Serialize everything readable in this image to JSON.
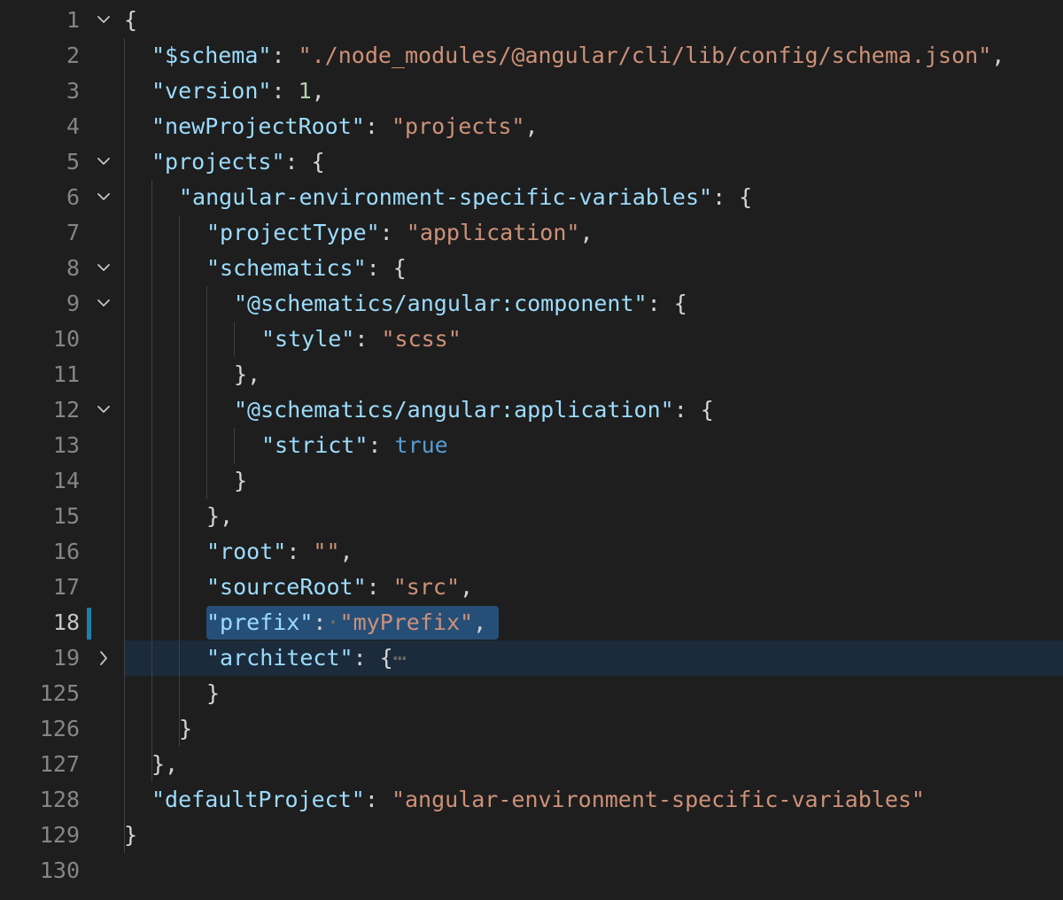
{
  "editor": {
    "lines": [
      {
        "num": "1",
        "fold": "open",
        "tokens": [
          {
            "t": "p",
            "v": "{"
          }
        ]
      },
      {
        "num": "2",
        "fold": "",
        "tokens": [
          {
            "t": "k",
            "v": "\"$schema\""
          },
          {
            "t": "p",
            "v": ": "
          },
          {
            "t": "s",
            "v": "\"./node_modules/@angular/cli/lib/config/schema.json\""
          },
          {
            "t": "p",
            "v": ","
          }
        ]
      },
      {
        "num": "3",
        "fold": "",
        "tokens": [
          {
            "t": "k",
            "v": "\"version\""
          },
          {
            "t": "p",
            "v": ": "
          },
          {
            "t": "n",
            "v": "1"
          },
          {
            "t": "p",
            "v": ","
          }
        ]
      },
      {
        "num": "4",
        "fold": "",
        "tokens": [
          {
            "t": "k",
            "v": "\"newProjectRoot\""
          },
          {
            "t": "p",
            "v": ": "
          },
          {
            "t": "s",
            "v": "\"projects\""
          },
          {
            "t": "p",
            "v": ","
          }
        ]
      },
      {
        "num": "5",
        "fold": "open",
        "tokens": [
          {
            "t": "k",
            "v": "\"projects\""
          },
          {
            "t": "p",
            "v": ": {"
          }
        ]
      },
      {
        "num": "6",
        "fold": "open",
        "tokens": [
          {
            "t": "k",
            "v": "\"angular-environment-specific-variables\""
          },
          {
            "t": "p",
            "v": ": {"
          }
        ]
      },
      {
        "num": "7",
        "fold": "",
        "tokens": [
          {
            "t": "k",
            "v": "\"projectType\""
          },
          {
            "t": "p",
            "v": ": "
          },
          {
            "t": "s",
            "v": "\"application\""
          },
          {
            "t": "p",
            "v": ","
          }
        ]
      },
      {
        "num": "8",
        "fold": "open",
        "tokens": [
          {
            "t": "k",
            "v": "\"schematics\""
          },
          {
            "t": "p",
            "v": ": {"
          }
        ]
      },
      {
        "num": "9",
        "fold": "open",
        "tokens": [
          {
            "t": "k",
            "v": "\"@schematics/angular:component\""
          },
          {
            "t": "p",
            "v": ": {"
          }
        ]
      },
      {
        "num": "10",
        "fold": "",
        "tokens": [
          {
            "t": "k",
            "v": "\"style\""
          },
          {
            "t": "p",
            "v": ": "
          },
          {
            "t": "s",
            "v": "\"scss\""
          }
        ]
      },
      {
        "num": "11",
        "fold": "",
        "tokens": [
          {
            "t": "p",
            "v": "},"
          }
        ]
      },
      {
        "num": "12",
        "fold": "open",
        "tokens": [
          {
            "t": "k",
            "v": "\"@schematics/angular:application\""
          },
          {
            "t": "p",
            "v": ": {"
          }
        ]
      },
      {
        "num": "13",
        "fold": "",
        "tokens": [
          {
            "t": "k",
            "v": "\"strict\""
          },
          {
            "t": "p",
            "v": ": "
          },
          {
            "t": "b",
            "v": "true"
          }
        ]
      },
      {
        "num": "14",
        "fold": "",
        "tokens": [
          {
            "t": "p",
            "v": "}"
          }
        ]
      },
      {
        "num": "15",
        "fold": "",
        "tokens": [
          {
            "t": "p",
            "v": "},"
          }
        ]
      },
      {
        "num": "16",
        "fold": "",
        "tokens": [
          {
            "t": "k",
            "v": "\"root\""
          },
          {
            "t": "p",
            "v": ": "
          },
          {
            "t": "s",
            "v": "\"\""
          },
          {
            "t": "p",
            "v": ","
          }
        ]
      },
      {
        "num": "17",
        "fold": "",
        "tokens": [
          {
            "t": "k",
            "v": "\"sourceRoot\""
          },
          {
            "t": "p",
            "v": ": "
          },
          {
            "t": "s",
            "v": "\"src\""
          },
          {
            "t": "p",
            "v": ","
          }
        ]
      },
      {
        "num": "18",
        "fold": "",
        "tokens": [
          {
            "t": "k",
            "v": "\"prefix\""
          },
          {
            "t": "p",
            "v": ":"
          },
          {
            "t": "dim",
            "v": "·"
          },
          {
            "t": "s",
            "v": "\"myPrefix\""
          },
          {
            "t": "p",
            "v": ","
          }
        ]
      },
      {
        "num": "19",
        "fold": "closed",
        "tokens": [
          {
            "t": "k",
            "v": "\"architect\""
          },
          {
            "t": "p",
            "v": ": {"
          },
          {
            "t": "dim",
            "v": "⋯"
          }
        ]
      },
      {
        "num": "125",
        "fold": "",
        "tokens": [
          {
            "t": "p",
            "v": "}"
          }
        ]
      },
      {
        "num": "126",
        "fold": "",
        "tokens": [
          {
            "t": "p",
            "v": "}"
          }
        ]
      },
      {
        "num": "127",
        "fold": "",
        "tokens": [
          {
            "t": "p",
            "v": "},"
          }
        ]
      },
      {
        "num": "128",
        "fold": "",
        "tokens": [
          {
            "t": "k",
            "v": "\"defaultProject\""
          },
          {
            "t": "p",
            "v": ": "
          },
          {
            "t": "s",
            "v": "\"angular-environment-specific-variables\""
          }
        ]
      },
      {
        "num": "129",
        "fold": "",
        "tokens": [
          {
            "t": "p",
            "v": "}"
          }
        ]
      },
      {
        "num": "130",
        "fold": "",
        "tokens": []
      }
    ],
    "active_line": "18",
    "colors": {
      "background": "#1e1e1e",
      "key": "#9cdcfe",
      "string": "#ce9178",
      "number": "#b5cea8",
      "boolean": "#569cd6",
      "selection": "#264f78",
      "modified_bar": "#1b81a8"
    }
  }
}
